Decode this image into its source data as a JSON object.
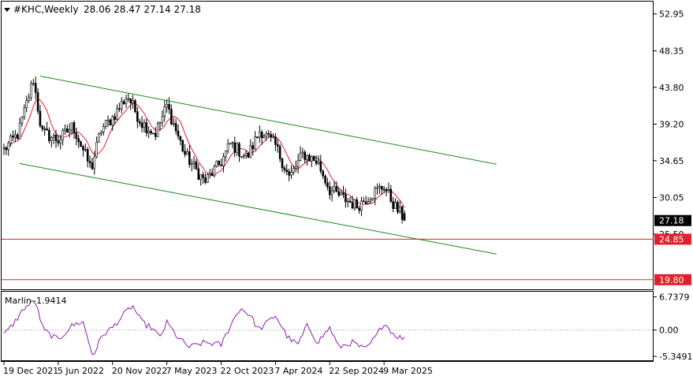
{
  "header": {
    "symbol": "#KHC,Weekly",
    "ohlc": "28.06 28.47 27.14 27.18"
  },
  "indicator": {
    "name": "Marlin",
    "value": "-1.9414"
  },
  "colors": {
    "candle_up": "#ffffff",
    "candle_down": "#000000",
    "ma_line": "#e0202a",
    "channel": "#1a8a1a",
    "support": "#e0202a",
    "oscillator": "#8b1fb0",
    "price_badge": "#000000",
    "level_badge": "#e0202a"
  },
  "chart_data": [
    {
      "type": "candlestick",
      "title": "#KHC,Weekly",
      "ylim": [
        18.5,
        54.3
      ],
      "y_ticks": [
        "52.95",
        "48.35",
        "43.80",
        "39.20",
        "34.65",
        "30.05",
        "25.50"
      ],
      "x_ticks": [
        "19 Dec 2021",
        "5 Jun 2022",
        "20 Nov 2022",
        "7 May 2023",
        "22 Oct 2023",
        "7 Apr 2024",
        "22 Sep 2024",
        "9 Mar 2025"
      ],
      "current_price": "27.18",
      "last_bar": {
        "open": 28.06,
        "high": 28.47,
        "low": 27.14,
        "close": 27.18
      },
      "close_path": [
        [
          "19 Dec 2021",
          36.0
        ],
        [
          "2022-02-01",
          38.0
        ],
        [
          "2022-03-20",
          44.8
        ],
        [
          "2022-04-15",
          38.2
        ],
        [
          "5 Jun 2022",
          37.2
        ],
        [
          "2022-07-20",
          39.0
        ],
        [
          "2022-09-15",
          33.6
        ],
        [
          "2022-10-15",
          38.5
        ],
        [
          "20 Nov 2022",
          40.0
        ],
        [
          "2023-01-05",
          42.8
        ],
        [
          "2023-02-15",
          39.5
        ],
        [
          "2023-04-01",
          38.0
        ],
        [
          "7 May 2023",
          41.5
        ],
        [
          "2023-07-01",
          35.5
        ],
        [
          "2023-09-01",
          32.0
        ],
        [
          "22 Oct 2023",
          34.5
        ],
        [
          "2023-11-20",
          36.8
        ],
        [
          "2024-01-10",
          35.0
        ],
        [
          "2024-02-20",
          38.5
        ],
        [
          "7 Apr 2024",
          36.5
        ],
        [
          "2024-05-20",
          32.5
        ],
        [
          "2024-07-01",
          35.5
        ],
        [
          "2024-08-15",
          34.5
        ],
        [
          "22 Sep 2024",
          31.0
        ],
        [
          "2024-11-01",
          30.0
        ],
        [
          "2024-12-15",
          29.0
        ],
        [
          "2025-01-30",
          30.5
        ],
        [
          "9 Mar 2025",
          31.5
        ],
        [
          "2025-04-10",
          29.0
        ],
        [
          "2025-05-15",
          27.18
        ]
      ],
      "levels": [
        {
          "label": "24.85",
          "value": 24.85
        },
        {
          "label": "19.80",
          "value": 19.8
        }
      ],
      "channel_lines": [
        {
          "name": "upper",
          "from": [
            "2022-04-10",
            45.2
          ],
          "to": [
            "2026-02-20",
            34.2
          ]
        },
        {
          "name": "lower",
          "from": [
            "2022-02-05",
            34.3
          ],
          "to": [
            "2026-02-20",
            23.0
          ]
        }
      ]
    },
    {
      "type": "line",
      "title": "Marlin -1.9414",
      "ylim": [
        -6.3,
        7.8
      ],
      "y_ticks": [
        "6.7379",
        "0.00",
        "-5.3491"
      ],
      "series": [
        {
          "points": [
            [
              "19 Dec 2021",
              -1.0
            ],
            [
              "2022-01-20",
              1.5
            ],
            [
              "2022-02-20",
              4.5
            ],
            [
              "2022-03-25",
              6.0
            ],
            [
              "2022-04-20",
              0.0
            ],
            [
              "5 Jun 2022",
              -2.0
            ],
            [
              "2022-07-15",
              0.8
            ],
            [
              "2022-08-20",
              1.8
            ],
            [
              "2022-09-20",
              -5.3
            ],
            [
              "2022-10-20",
              -1.0
            ],
            [
              "20 Nov 2022",
              0.5
            ],
            [
              "2022-12-20",
              2.8
            ],
            [
              "2023-01-20",
              5.0
            ],
            [
              "2023-02-20",
              1.5
            ],
            [
              "2023-03-20",
              0.5
            ],
            [
              "2023-04-15",
              -1.5
            ],
            [
              "7 May 2023",
              1.5
            ],
            [
              "2023-06-10",
              -1.5
            ],
            [
              "2023-07-15",
              -3.5
            ],
            [
              "2023-09-01",
              -2.5
            ],
            [
              "22 Oct 2023",
              -3.0
            ],
            [
              "2023-11-20",
              1.0
            ],
            [
              "2023-12-20",
              4.5
            ],
            [
              "2024-01-20",
              3.0
            ],
            [
              "2024-02-15",
              0.0
            ],
            [
              "7 Apr 2024",
              3.0
            ],
            [
              "2024-05-15",
              -1.5
            ],
            [
              "2024-06-15",
              -3.0
            ],
            [
              "2024-07-15",
              1.0
            ],
            [
              "2024-08-15",
              -2.5
            ],
            [
              "22 Sep 2024",
              0.5
            ],
            [
              "2024-10-20",
              -3.5
            ],
            [
              "2024-12-01",
              -2.5
            ],
            [
              "2025-01-10",
              -4.0
            ],
            [
              "2025-02-10",
              -1.5
            ],
            [
              "9 Mar 2025",
              1.5
            ],
            [
              "2025-04-10",
              -1.0
            ],
            [
              "2025-05-15",
              -1.94
            ]
          ]
        }
      ]
    }
  ]
}
